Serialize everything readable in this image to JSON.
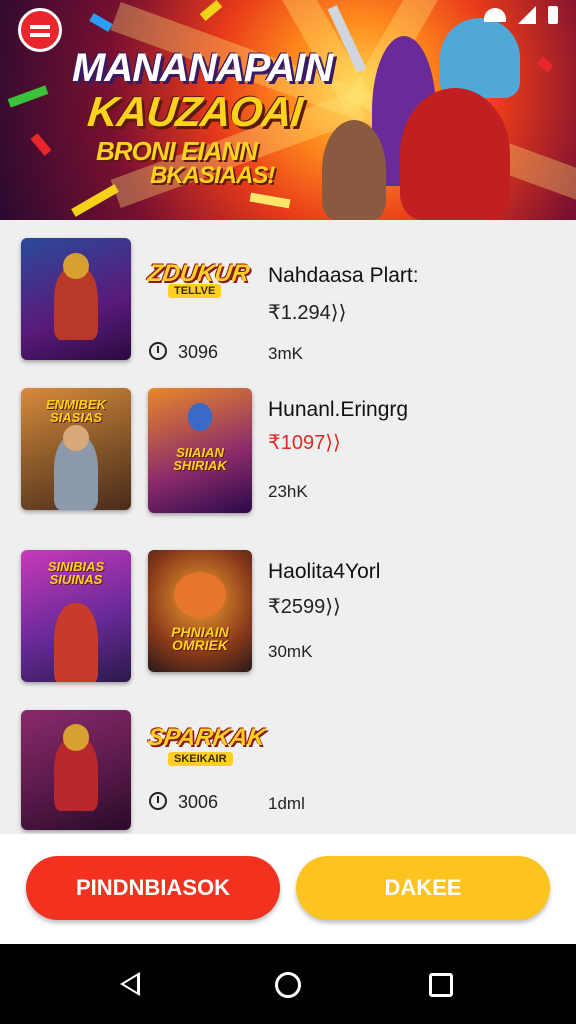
{
  "banner": {
    "title_line1": "MANANAPAIN",
    "title_line2": "KAUZAOAI",
    "title_line3": "BRONI EIANN",
    "title_line4": "BKASIAAS!"
  },
  "status_bar": {
    "icons": [
      "wifi-icon",
      "signal-icon",
      "battery-icon"
    ]
  },
  "games": [
    {
      "logo": "ZDUKUR",
      "logo_sub": "TELLVE",
      "name": "Nahdaasa Plart:",
      "price": "₹1.294⟩⟩",
      "count": "3096",
      "meta": "3mK"
    },
    {
      "thumb_caption": "ENMIBEK SIASIAS",
      "thumb2_caption": "SIIAIAN SHIRIAK",
      "name": "Hunanl.Eringrg",
      "price": "₹1097⟩⟩",
      "meta": "23hK"
    },
    {
      "thumb_caption": "SINIBIAS SIUINAS",
      "thumb2_caption": "PHNIAIN OMRIEK",
      "name": "Haolita4Yorl",
      "price": "₹2599⟩⟩",
      "meta": "30mK"
    },
    {
      "logo": "SPARKAK",
      "logo_sub": "SKEIKAIR",
      "count": "3006",
      "meta": "1dml"
    }
  ],
  "actions": {
    "primary": "PINDNBIASOK",
    "secondary": "DAKEE"
  },
  "colors": {
    "primary": "#f2321f",
    "secondary": "#fdc31f",
    "price_red": "#e02a26"
  },
  "nav": {
    "icons": [
      "back-icon",
      "home-icon",
      "recents-icon"
    ]
  }
}
